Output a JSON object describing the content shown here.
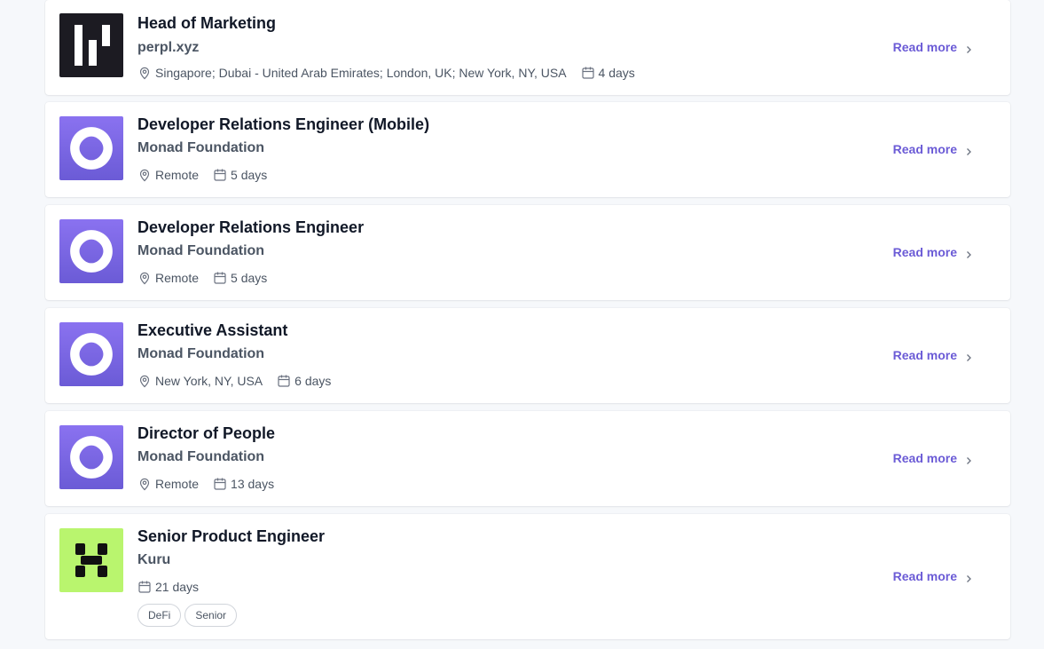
{
  "colors": {
    "accent": "#6b5bd6",
    "perpl_logo_bg": "#1c1b22",
    "monad_logo_bg": "#7b67e8",
    "kuru_logo_bg": "#b9f56e"
  },
  "read_more_label": "Read more",
  "jobs": [
    {
      "title": "Head of Marketing",
      "company": "perpl.xyz",
      "logo_icon": "perpl-logo",
      "location": "Singapore; Dubai - United Arab Emirates; London, UK; New York, NY, USA",
      "posted": "4 days",
      "tags": []
    },
    {
      "title": "Developer Relations Engineer (Mobile)",
      "company": "Monad Foundation",
      "logo_icon": "monad-logo",
      "location": "Remote",
      "posted": "5 days",
      "tags": []
    },
    {
      "title": "Developer Relations Engineer",
      "company": "Monad Foundation",
      "logo_icon": "monad-logo",
      "location": "Remote",
      "posted": "5 days",
      "tags": []
    },
    {
      "title": "Executive Assistant",
      "company": "Monad Foundation",
      "logo_icon": "monad-logo",
      "location": "New York, NY, USA",
      "posted": "6 days",
      "tags": []
    },
    {
      "title": "Director of People",
      "company": "Monad Foundation",
      "logo_icon": "monad-logo",
      "location": "Remote",
      "posted": "13 days",
      "tags": []
    },
    {
      "title": "Senior Product Engineer",
      "company": "Kuru",
      "logo_icon": "kuru-logo",
      "location": "",
      "posted": "21 days",
      "tags": [
        "DeFi",
        "Senior"
      ]
    }
  ]
}
